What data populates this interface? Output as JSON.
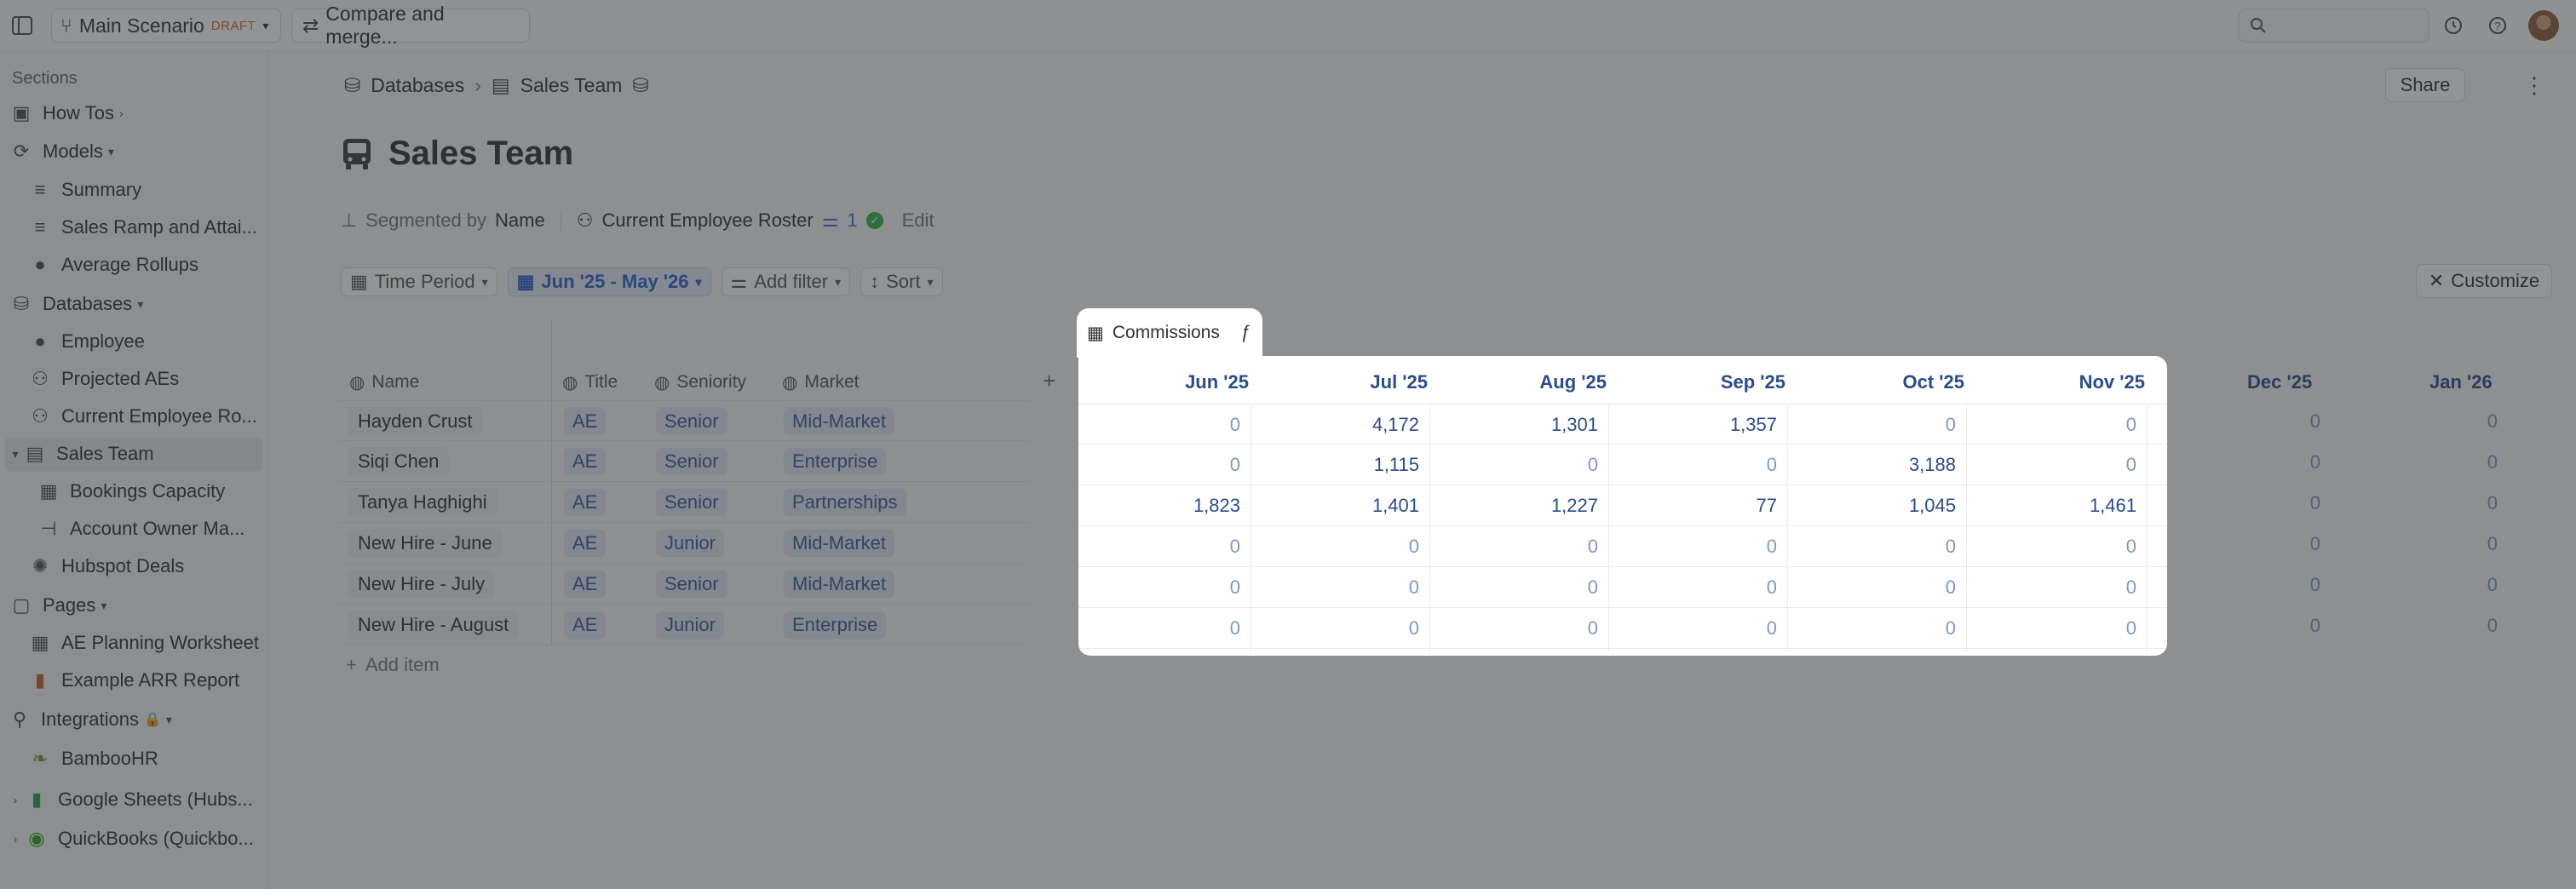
{
  "topbar": {
    "scenario_label": "Main Scenario",
    "draft_badge": "DRAFT",
    "compare_label": "Compare and merge..."
  },
  "sidebar": {
    "sections_title": "Sections",
    "items": [
      {
        "label": "How Tos",
        "icon": "book-icon"
      },
      {
        "label": "Models",
        "icon": "model-icon"
      },
      {
        "label": "Summary",
        "icon": "list-icon"
      },
      {
        "label": "Sales Ramp and Attai...",
        "icon": "list-icon"
      },
      {
        "label": "Average Rollups",
        "icon": "check-circle-icon"
      },
      {
        "label": "Databases",
        "icon": "database-icon"
      },
      {
        "label": "Employee",
        "icon": "person-icon"
      },
      {
        "label": "Projected AEs",
        "icon": "people-icon"
      },
      {
        "label": "Current Employee Ro...",
        "icon": "people-icon"
      },
      {
        "label": "Sales Team",
        "icon": "bus-icon"
      },
      {
        "label": "Bookings Capacity",
        "icon": "table-icon"
      },
      {
        "label": "Account Owner Ma...",
        "icon": "tree-icon"
      },
      {
        "label": "Hubspot Deals",
        "icon": "hubspot-icon"
      },
      {
        "label": "Pages",
        "icon": "page-icon"
      },
      {
        "label": "AE Planning Worksheet",
        "icon": "table-icon"
      },
      {
        "label": "Example ARR Report",
        "icon": "bar-chart-icon"
      },
      {
        "label": "Integrations",
        "icon": "plug-icon"
      },
      {
        "label": "BambooHR",
        "icon": "bamboo-icon"
      },
      {
        "label": "Google Sheets (Hubs...",
        "icon": "sheets-icon"
      },
      {
        "label": "QuickBooks (Quickbo...",
        "icon": "quickbooks-icon"
      }
    ]
  },
  "breadcrumb": {
    "root": "Databases",
    "current": "Sales Team"
  },
  "share_label": "Share",
  "page_title": "Sales Team",
  "segment": {
    "label": "Segmented by",
    "field": "Name",
    "source": "Current Employee Roster",
    "filter_count": "1",
    "edit": "Edit"
  },
  "filters": {
    "time_period": "Time Period",
    "date_range": "Jun '25 - May '26",
    "add_filter": "Add filter",
    "sort": "Sort",
    "customize": "Customize"
  },
  "table": {
    "columns": [
      "Name",
      "Title",
      "Seniority",
      "Market"
    ],
    "rows": [
      {
        "name": "Hayden Crust",
        "title": "AE",
        "seniority": "Senior",
        "market": "Mid-Market"
      },
      {
        "name": "Siqi Chen",
        "title": "AE",
        "seniority": "Senior",
        "market": "Enterprise"
      },
      {
        "name": "Tanya Haghighi",
        "title": "AE",
        "seniority": "Senior",
        "market": "Partnerships"
      },
      {
        "name": "New Hire - June",
        "title": "AE",
        "seniority": "Junior",
        "market": "Mid-Market"
      },
      {
        "name": "New Hire - July",
        "title": "AE",
        "seniority": "Senior",
        "market": "Mid-Market"
      },
      {
        "name": "New Hire - August",
        "title": "AE",
        "seniority": "Junior",
        "market": "Enterprise"
      }
    ],
    "add_item": "Add item"
  },
  "commissions": {
    "tab_label": "Commissions",
    "months": [
      "Jun '25",
      "Jul '25",
      "Aug '25",
      "Sep '25",
      "Oct '25",
      "Nov '25"
    ],
    "values": [
      [
        "0",
        "4,172",
        "1,301",
        "1,357",
        "0",
        "0"
      ],
      [
        "0",
        "1,115",
        "0",
        "0",
        "3,188",
        "0"
      ],
      [
        "1,823",
        "1,401",
        "1,227",
        "77",
        "1,045",
        "1,461"
      ],
      [
        "0",
        "0",
        "0",
        "0",
        "0",
        "0"
      ],
      [
        "0",
        "0",
        "0",
        "0",
        "0",
        "0"
      ],
      [
        "0",
        "0",
        "0",
        "0",
        "0",
        "0"
      ]
    ]
  },
  "more_months": {
    "months": [
      "Dec '25",
      "Jan '26"
    ],
    "values": [
      [
        "0",
        "0"
      ],
      [
        "0",
        "0"
      ],
      [
        "0",
        "0"
      ],
      [
        "0",
        "0"
      ],
      [
        "0",
        "0"
      ],
      [
        "0",
        "0"
      ]
    ]
  }
}
